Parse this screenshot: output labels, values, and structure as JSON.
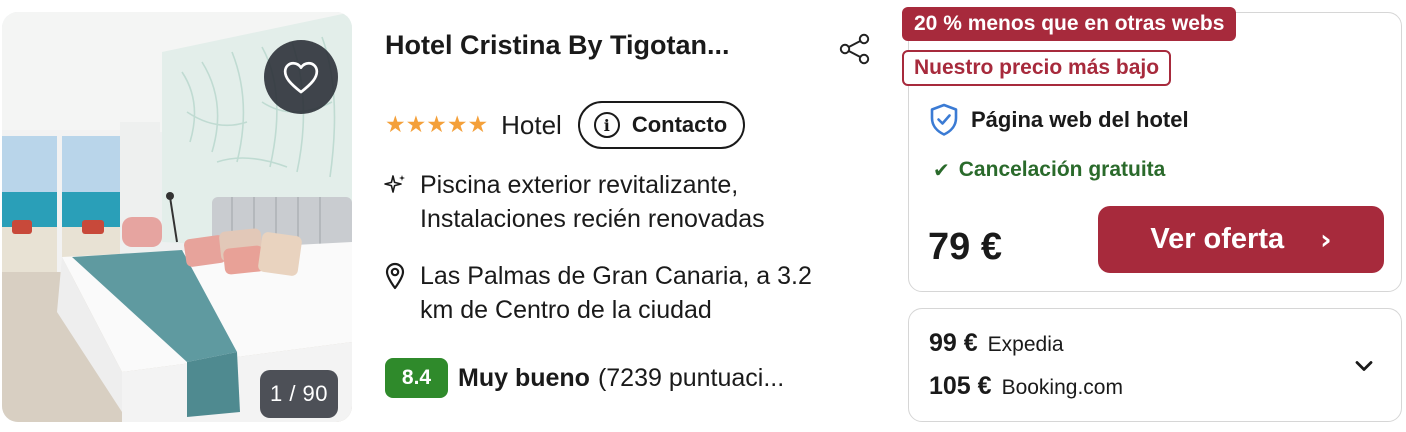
{
  "photo": {
    "counter": "1 / 90",
    "favorite_icon": "heart-outline-icon"
  },
  "hotel": {
    "name": "Hotel Cristina By Tigotan...",
    "share_icon": "share-icon",
    "stars": "★★★★★",
    "star_count": 5,
    "type": "Hotel",
    "contact_label": "Contacto"
  },
  "features": {
    "amenities_icon": "sparkle-icon",
    "amenities_line1": "Piscina exterior revitalizante,",
    "amenities_line2": "Instalaciones recién renovadas",
    "location_icon": "map-pin-icon",
    "location_line1": "Las Palmas de Gran Canaria, a 3.2",
    "location_line2": "km de Centro de la ciudad"
  },
  "rating": {
    "score": "8.4",
    "label": "Muy bueno",
    "count": "(7239 puntuaci..."
  },
  "deal": {
    "badge_discount": "20 % menos que en otras webs",
    "badge_lowest": "Nuestro precio más bajo",
    "provider": "Página web del hotel",
    "cancellation": "Cancelación gratuita",
    "price": "79 €",
    "cta_label": "Ver oferta",
    "colors": {
      "accent": "#a72a3c",
      "green": "#2a6a2b",
      "score_bg": "#2f8a2b",
      "stars": "#f4a03a"
    }
  },
  "alternatives": [
    {
      "price": "99 €",
      "site": "Expedia"
    },
    {
      "price": "105 €",
      "site": "Booking.com"
    }
  ]
}
